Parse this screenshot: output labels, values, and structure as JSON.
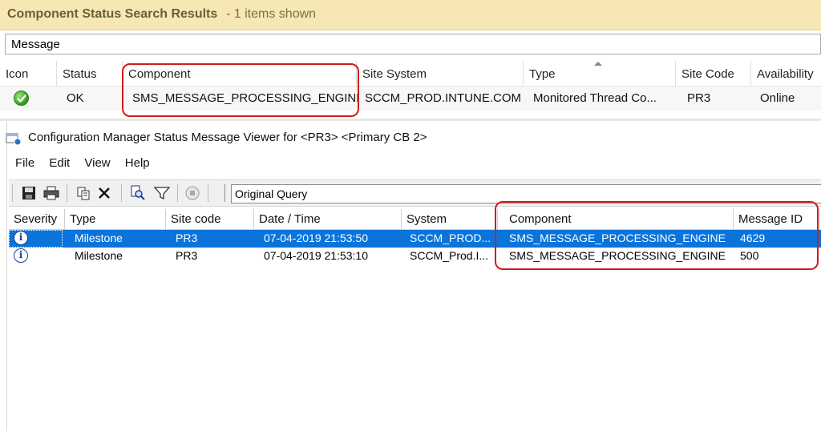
{
  "results": {
    "title": "Component Status Search Results",
    "count_text": "-   1 items shown",
    "filter_placeholder": "Message",
    "columns": [
      "Icon",
      "Status",
      "Component",
      "Site System",
      "Type",
      "Site Code",
      "Availability"
    ],
    "row": {
      "icon": "ok-check-icon",
      "status": "OK",
      "component": "SMS_MESSAGE_PROCESSING_ENGINE",
      "site_system": "SCCM_PROD.INTUNE.COM",
      "type": "Monitored Thread Co...",
      "site_code": "PR3",
      "availability": "Online"
    }
  },
  "viewer": {
    "title": "Configuration Manager Status Message Viewer for <PR3>  <Primary CB 2>",
    "menu": [
      "File",
      "Edit",
      "View",
      "Help"
    ],
    "toolbar_icons": [
      "save-icon",
      "print-icon",
      "copy-icon",
      "delete-icon",
      "find-icon",
      "filter-icon",
      "stop-icon"
    ],
    "query": "Original Query",
    "columns": [
      "Severity",
      "Type",
      "Site code",
      "Date / Time",
      "System",
      "Component",
      "Message ID"
    ],
    "rows": [
      {
        "severity_icon": "info-icon",
        "type": "Milestone",
        "site_code": "PR3",
        "datetime": "07-04-2019 21:53:50",
        "system": "SCCM_PROD...",
        "component": "SMS_MESSAGE_PROCESSING_ENGINE",
        "message_id": "4629",
        "selected": true
      },
      {
        "severity_icon": "info-icon",
        "type": "Milestone",
        "site_code": "PR3",
        "datetime": "07-04-2019 21:53:10",
        "system": "SCCM_Prod.I...",
        "component": "SMS_MESSAGE_PROCESSING_ENGINE",
        "message_id": "500",
        "selected": false
      }
    ]
  },
  "colors": {
    "header_bg": "#f6e7b5",
    "selection": "#0a74da",
    "highlight_box": "#d11b1b",
    "ok_green": "#2e9a1e"
  }
}
